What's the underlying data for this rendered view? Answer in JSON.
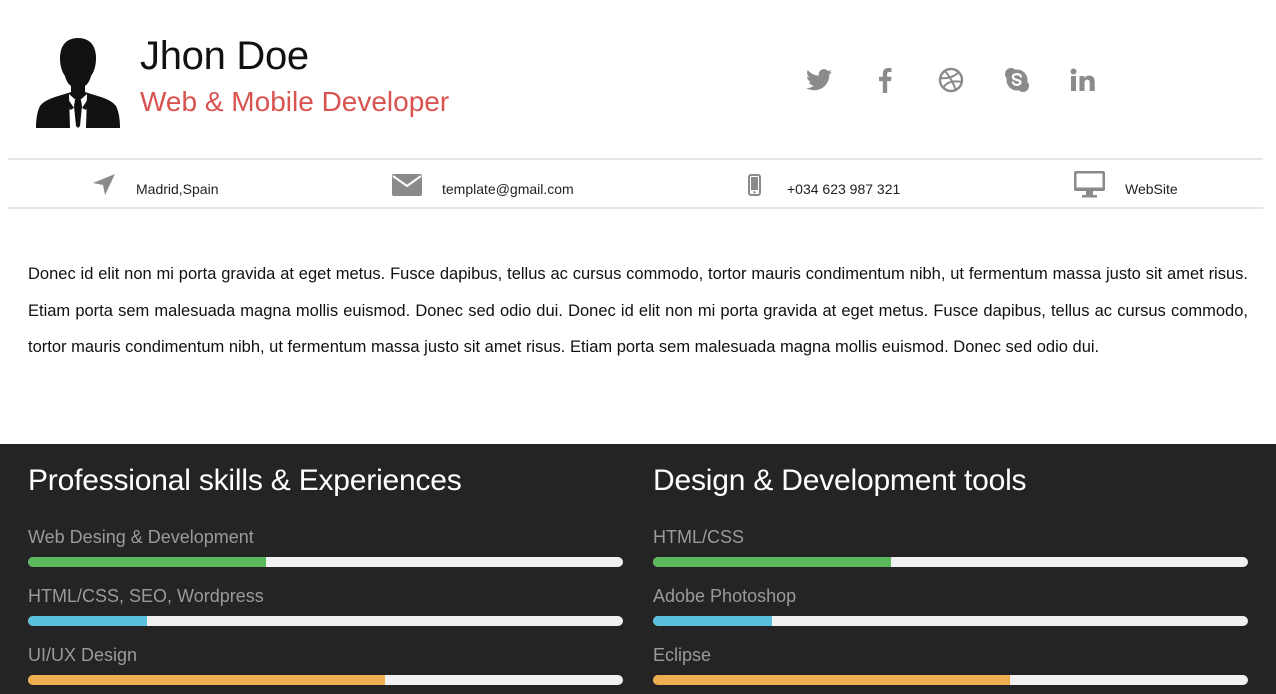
{
  "profile": {
    "name": "Jhon Doe",
    "role": "Web & Mobile Developer"
  },
  "social": [
    {
      "icon": "twitter-icon"
    },
    {
      "icon": "facebook-icon"
    },
    {
      "icon": "dribbble-icon"
    },
    {
      "icon": "skype-icon"
    },
    {
      "icon": "linkedin-icon"
    }
  ],
  "contact": {
    "location": "Madrid,Spain",
    "email": "template@gmail.com",
    "phone": "+034 623 987 321",
    "website": "WebSite"
  },
  "about": "Donec id elit non mi porta gravida at eget metus. Fusce dapibus, tellus ac cursus commodo, tortor mauris condimentum nibh, ut fermentum massa justo sit amet risus. Etiam porta sem malesuada magna mollis euismod. Donec sed odio dui. Donec id elit non mi porta gravida at eget metus. Fusce dapibus, tellus ac cursus commodo, tortor mauris condimentum nibh, ut fermentum massa justo sit amet risus. Etiam porta sem malesuada magna mollis euismod. Donec sed odio dui.",
  "skills": {
    "title": "Professional skills & Experiences",
    "items": [
      {
        "label": "Web Desing & Development",
        "level": 0.4,
        "color": "#5cb85c"
      },
      {
        "label": "HTML/CSS, SEO, Wordpress",
        "level": 0.2,
        "color": "#5bc0de"
      },
      {
        "label": "UI/UX Design",
        "level": 0.6,
        "color": "#f0ad4e"
      }
    ]
  },
  "tools": {
    "title": "Design & Development tools",
    "items": [
      {
        "label": "HTML/CSS",
        "level": 0.4,
        "color": "#5cb85c"
      },
      {
        "label": "Adobe Photoshop",
        "level": 0.2,
        "color": "#5bc0de"
      },
      {
        "label": "Eclipse",
        "level": 0.6,
        "color": "#f0ad4e"
      }
    ]
  }
}
